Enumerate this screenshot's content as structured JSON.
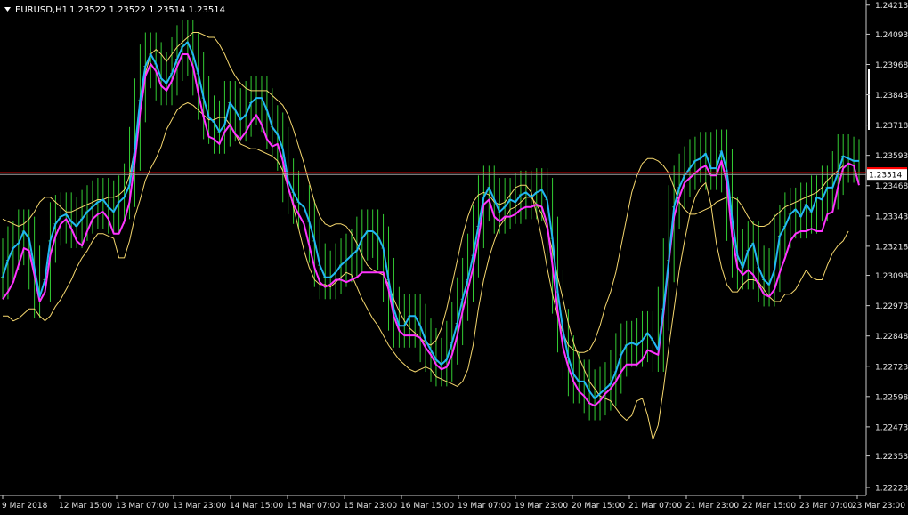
{
  "header": {
    "symbol": "EURUSD,H1",
    "ohlc": "1.23522 1.23522 1.23514 1.23514"
  },
  "colors": {
    "background": "#000000",
    "axis": "#c8c8c8",
    "bars": "#33cc33",
    "ma_fast": "#22b7f2",
    "ma_mid": "#ff33ff",
    "envelope": "#f5d76e",
    "bid_line": "#d10000",
    "bid_bg": "#ff0000",
    "ask_line": "#a0a0a0"
  },
  "chart_data": {
    "type": "line",
    "title": "EURUSD,H1",
    "y_range": [
      1.2219,
      1.24234
    ],
    "y_ticks": [
      "1.24213",
      "1.24093",
      "1.23968",
      "1.23843",
      "1.23718",
      "1.23593",
      "1.23468",
      "1.23343",
      "1.23218",
      "1.23098",
      "1.22973",
      "1.22848",
      "1.22723",
      "1.22598",
      "1.22473",
      "1.22353",
      "1.22223"
    ],
    "x_ticks": [
      "9 Mar 2018",
      "12 Mar 15:00",
      "13 Mar 07:00",
      "13 Mar 23:00",
      "14 Mar 15:00",
      "15 Mar 07:00",
      "15 Mar 23:00",
      "16 Mar 15:00",
      "19 Mar 07:00",
      "19 Mar 23:00",
      "20 Mar 15:00",
      "21 Mar 07:00",
      "21 Mar 23:00",
      "22 Mar 15:00",
      "23 Mar 07:00",
      "23 Mar 23:00"
    ],
    "price_tags": [
      {
        "label": "1.23522",
        "value": 1.23522,
        "kind": "bid"
      },
      {
        "label": "1.23514",
        "value": 1.23514,
        "kind": "ask"
      }
    ],
    "series": [
      {
        "role": "ma_fast",
        "values": [
          1.2309,
          1.2316,
          1.2321,
          1.2323,
          1.2328,
          1.2325,
          1.2313,
          1.2301,
          1.2308,
          1.2324,
          1.2331,
          1.2334,
          1.2335,
          1.2332,
          1.233,
          1.2333,
          1.2336,
          1.2338,
          1.234,
          1.2341,
          1.2338,
          1.2336,
          1.234,
          1.2342,
          1.2347,
          1.2362,
          1.2382,
          1.2396,
          1.2401,
          1.2397,
          1.2391,
          1.2389,
          1.2393,
          1.2399,
          1.2404,
          1.2406,
          1.2401,
          1.2393,
          1.2383,
          1.2375,
          1.2373,
          1.2369,
          1.2372,
          1.2381,
          1.2378,
          1.2374,
          1.2376,
          1.2381,
          1.2383,
          1.2383,
          1.2378,
          1.2371,
          1.2368,
          1.2362,
          1.2349,
          1.2344,
          1.234,
          1.2338,
          1.2332,
          1.2324,
          1.2314,
          1.2309,
          1.2309,
          1.2311,
          1.2314,
          1.2316,
          1.2318,
          1.232,
          1.2325,
          1.2328,
          1.2328,
          1.2326,
          1.2321,
          1.2308,
          1.2296,
          1.2289,
          1.2289,
          1.2293,
          1.2293,
          1.2289,
          1.2283,
          1.2279,
          1.2275,
          1.2273,
          1.2275,
          1.2282,
          1.229,
          1.23,
          1.2308,
          1.2318,
          1.233,
          1.2342,
          1.2346,
          1.2341,
          1.2336,
          1.2338,
          1.2341,
          1.234,
          1.2343,
          1.2344,
          1.2342,
          1.2344,
          1.2345,
          1.2341,
          1.2325,
          1.2303,
          1.2287,
          1.2276,
          1.2269,
          1.2266,
          1.2266,
          1.2262,
          1.2259,
          1.2261,
          1.2263,
          1.2265,
          1.227,
          1.2277,
          1.2281,
          1.2282,
          1.2281,
          1.2283,
          1.2286,
          1.2283,
          1.2279,
          1.2296,
          1.2316,
          1.2338,
          1.2346,
          1.2351,
          1.2354,
          1.2357,
          1.2358,
          1.236,
          1.2354,
          1.2354,
          1.2361,
          1.2353,
          1.2333,
          1.2318,
          1.2313,
          1.232,
          1.2323,
          1.2313,
          1.2308,
          1.2306,
          1.2312,
          1.2326,
          1.233,
          1.2335,
          1.2337,
          1.2334,
          1.2339,
          1.2336,
          1.2342,
          1.2341,
          1.2346,
          1.2346,
          1.2352,
          1.2359,
          1.2358,
          1.2357,
          1.2357
        ]
      },
      {
        "role": "ma_mid",
        "values": [
          1.23,
          1.2303,
          1.2307,
          1.2314,
          1.2321,
          1.232,
          1.231,
          1.2299,
          1.2303,
          1.2318,
          1.2326,
          1.2331,
          1.2333,
          1.2329,
          1.2324,
          1.2322,
          1.2328,
          1.2333,
          1.2335,
          1.2336,
          1.2333,
          1.2327,
          1.2327,
          1.2332,
          1.234,
          1.2357,
          1.2377,
          1.2392,
          1.2397,
          1.2394,
          1.2388,
          1.2386,
          1.239,
          1.2396,
          1.2401,
          1.2401,
          1.2396,
          1.2385,
          1.2375,
          1.2367,
          1.2366,
          1.2364,
          1.2369,
          1.2372,
          1.2368,
          1.2366,
          1.2369,
          1.2373,
          1.2376,
          1.2372,
          1.2366,
          1.2363,
          1.2364,
          1.2357,
          1.2346,
          1.2339,
          1.2335,
          1.2331,
          1.2322,
          1.2313,
          1.2307,
          1.2305,
          1.2306,
          1.2308,
          1.2308,
          1.2307,
          1.2308,
          1.2309,
          1.2311,
          1.2311,
          1.2311,
          1.2311,
          1.2311,
          1.2304,
          1.2293,
          1.2287,
          1.2285,
          1.2285,
          1.2285,
          1.2284,
          1.228,
          1.2277,
          1.2273,
          1.2271,
          1.2272,
          1.2277,
          1.2285,
          1.2295,
          1.2304,
          1.2313,
          1.2325,
          1.2339,
          1.2341,
          1.2334,
          1.2332,
          1.2334,
          1.2334,
          1.2335,
          1.2337,
          1.2338,
          1.2338,
          1.2339,
          1.2338,
          1.2331,
          1.2314,
          1.2295,
          1.228,
          1.2272,
          1.2266,
          1.2262,
          1.226,
          1.2257,
          1.2256,
          1.2258,
          1.2261,
          1.2263,
          1.2266,
          1.227,
          1.2273,
          1.2273,
          1.2273,
          1.2275,
          1.2279,
          1.2278,
          1.2277,
          1.2294,
          1.2315,
          1.2334,
          1.2342,
          1.2348,
          1.235,
          1.2352,
          1.2354,
          1.2355,
          1.2351,
          1.2351,
          1.2357,
          1.2348,
          1.2326,
          1.2313,
          1.231,
          1.2312,
          1.231,
          1.2306,
          1.2302,
          1.2301,
          1.2304,
          1.2311,
          1.2317,
          1.2324,
          1.2327,
          1.2328,
          1.2328,
          1.2329,
          1.2328,
          1.2328,
          1.2335,
          1.2336,
          1.2346,
          1.2354,
          1.2356,
          1.2355,
          1.2347
        ]
      },
      {
        "role": "envelope_upper",
        "values": [
          1.2333,
          1.2332,
          1.2331,
          1.233,
          1.2331,
          1.2333,
          1.2336,
          1.234,
          1.2342,
          1.2342,
          1.234,
          1.2338,
          1.2336,
          1.2336,
          1.2337,
          1.2338,
          1.2339,
          1.234,
          1.2341,
          1.2341,
          1.2342,
          1.2342,
          1.2343,
          1.2345,
          1.2351,
          1.2362,
          1.2378,
          1.2393,
          1.2401,
          1.2403,
          1.2401,
          1.2398,
          1.2401,
          1.2404,
          1.2406,
          1.2408,
          1.241,
          1.241,
          1.2409,
          1.2408,
          1.2408,
          1.2405,
          1.2401,
          1.2396,
          1.2392,
          1.2389,
          1.2387,
          1.2386,
          1.2386,
          1.2386,
          1.2386,
          1.2384,
          1.2382,
          1.238,
          1.2376,
          1.237,
          1.2363,
          1.2356,
          1.2348,
          1.234,
          1.2334,
          1.2331,
          1.233,
          1.2331,
          1.2331,
          1.233,
          1.2327,
          1.2323,
          1.2318,
          1.2314,
          1.2312,
          1.2311,
          1.231,
          1.2306,
          1.23,
          1.2295,
          1.2291,
          1.2288,
          1.2286,
          1.2284,
          1.2282,
          1.2281,
          1.2283,
          1.2288,
          1.2296,
          1.2306,
          1.2316,
          1.2326,
          1.2334,
          1.234,
          1.2343,
          1.2344,
          1.2343,
          1.234,
          1.2339,
          1.234,
          1.2343,
          1.2346,
          1.2347,
          1.2347,
          1.2344,
          1.2335,
          1.2325,
          1.2313,
          1.2302,
          1.2293,
          1.2286,
          1.2281,
          1.2279,
          1.2278,
          1.2278,
          1.2279,
          1.2283,
          1.2289,
          1.2297,
          1.2303,
          1.2311,
          1.2322,
          1.2333,
          1.2344,
          1.2351,
          1.2356,
          1.2358,
          1.2358,
          1.2357,
          1.2355,
          1.2352,
          1.2346,
          1.234,
          1.2337,
          1.2335,
          1.2335,
          1.2336,
          1.2337,
          1.2338,
          1.234,
          1.2341,
          1.2342,
          1.2342,
          1.2341,
          1.2338,
          1.2334,
          1.2331,
          1.233,
          1.233,
          1.2331,
          1.2334,
          1.2336,
          1.2338,
          1.2339,
          1.234,
          1.2341,
          1.2342,
          1.2343,
          1.2344,
          1.2346,
          1.2349,
          1.2351,
          1.2353,
          1.2355
        ]
      },
      {
        "role": "envelope_lower",
        "values": [
          1.2293,
          1.2293,
          1.2291,
          1.2292,
          1.2294,
          1.2296,
          1.2296,
          1.2293,
          1.2291,
          1.2293,
          1.2297,
          1.23,
          1.2304,
          1.2308,
          1.2313,
          1.2317,
          1.232,
          1.2324,
          1.2327,
          1.2327,
          1.2326,
          1.2325,
          1.2317,
          1.2317,
          1.2324,
          1.2334,
          1.2341,
          1.2349,
          1.2354,
          1.2358,
          1.2363,
          1.237,
          1.2374,
          1.2378,
          1.238,
          1.2381,
          1.238,
          1.2378,
          1.2376,
          1.2374,
          1.2374,
          1.2375,
          1.2375,
          1.2372,
          1.2368,
          1.2364,
          1.2363,
          1.2362,
          1.2362,
          1.2361,
          1.236,
          1.2359,
          1.2357,
          1.2353,
          1.2346,
          1.2338,
          1.2329,
          1.232,
          1.2313,
          1.2308,
          1.2306,
          1.2306,
          1.2305,
          1.2307,
          1.2309,
          1.2311,
          1.231,
          1.2305,
          1.23,
          1.2296,
          1.2292,
          1.2289,
          1.2285,
          1.2281,
          1.2278,
          1.2275,
          1.2273,
          1.2271,
          1.227,
          1.2271,
          1.2272,
          1.2271,
          1.2268,
          1.2267,
          1.2266,
          1.2265,
          1.2264,
          1.2266,
          1.2271,
          1.2281,
          1.2296,
          1.2308,
          1.2317,
          1.2324,
          1.233,
          1.2333,
          1.2337,
          1.2338,
          1.234,
          1.2342,
          1.2342,
          1.2339,
          1.2335,
          1.2329,
          1.232,
          1.2309,
          1.23,
          1.229,
          1.2282,
          1.2276,
          1.2271,
          1.2266,
          1.2263,
          1.226,
          1.2259,
          1.2258,
          1.2255,
          1.2252,
          1.225,
          1.2252,
          1.2258,
          1.2259,
          1.2252,
          1.2242,
          1.2248,
          1.2263,
          1.228,
          1.2296,
          1.2312,
          1.2324,
          1.2335,
          1.2342,
          1.2346,
          1.2348,
          1.2339,
          1.2323,
          1.2313,
          1.2306,
          1.2303,
          1.2303,
          1.2306,
          1.2308,
          1.2308,
          1.2307,
          1.2304,
          1.2301,
          1.2299,
          1.2299,
          1.2302,
          1.2302,
          1.2304,
          1.2308,
          1.2312,
          1.2309,
          1.2308,
          1.2308,
          1.2314,
          1.2319,
          1.2322,
          1.2324,
          1.2328
        ]
      }
    ]
  }
}
